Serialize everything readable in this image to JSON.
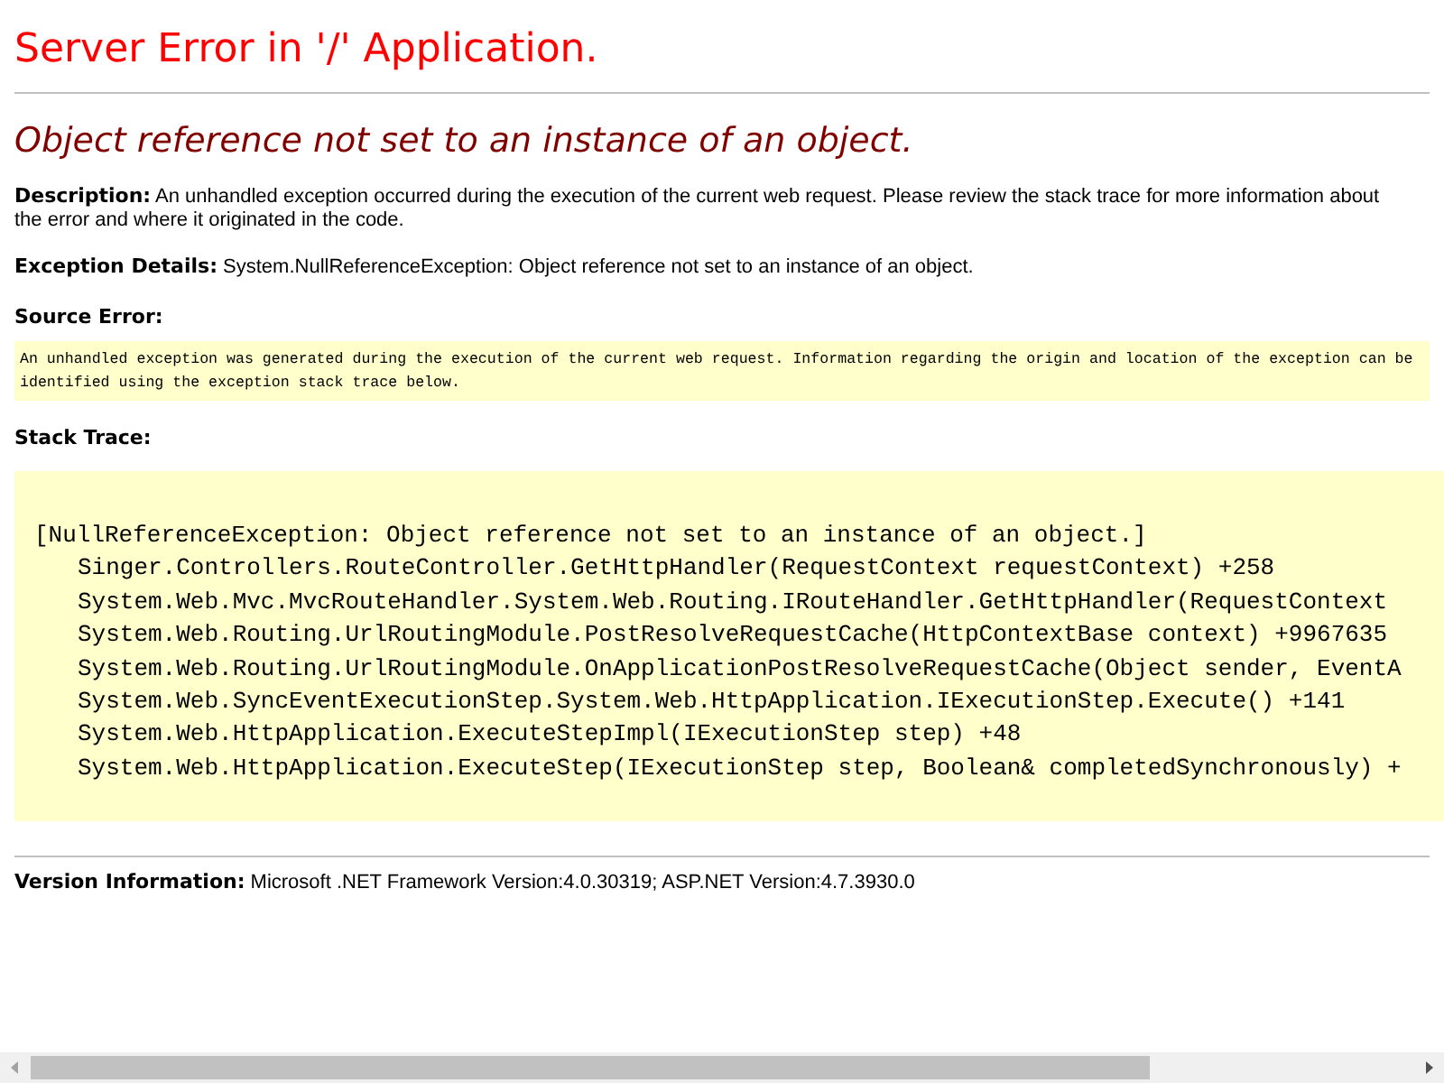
{
  "title": "Server Error in '/' Application.",
  "heading": "Object reference not set to an instance of an object.",
  "description": "**Description:** An unhandled exception occurred during the execution of the current web request. Please review the stack trace for more information about the error and where it originated in the code.",
  "exception_details": "**Exception Details:** System.NullReferenceException: Object reference not set to an instance of an object.",
  "source_error": {
    "label": "Source Error:",
    "text": "An unhandled exception was generated during the execution of the current web request. Information regarding the origin and location of the exception can be identified using the exception stack trace below."
  },
  "stack_trace": {
    "label": "Stack Trace:",
    "exception": "[NullReferenceException: Object reference not set to an instance of an object.]",
    "frames": [
      "Singer.Controllers.RouteController.GetHttpHandler(RequestContext requestContext) +258",
      "System.Web.Mvc.MvcRouteHandler.System.Web.Routing.IRouteHandler.GetHttpHandler(RequestContext",
      "System.Web.Routing.UrlRoutingModule.PostResolveRequestCache(HttpContextBase context) +9967635",
      "System.Web.Routing.UrlRoutingModule.OnApplicationPostResolveRequestCache(Object sender, EventA",
      "System.Web.SyncEventExecutionStep.System.Web.HttpApplication.IExecutionStep.Execute() +141",
      "System.Web.HttpApplication.ExecuteStepImpl(IExecutionStep step) +48",
      "System.Web.HttpApplication.ExecuteStep(IExecutionStep step, Boolean& completedSynchronously) +"
    ]
  },
  "version_info": "**Version Information:** Microsoft .NET Framework Version:4.0.30319; ASP.NET Version:4.7.3930.0"
}
